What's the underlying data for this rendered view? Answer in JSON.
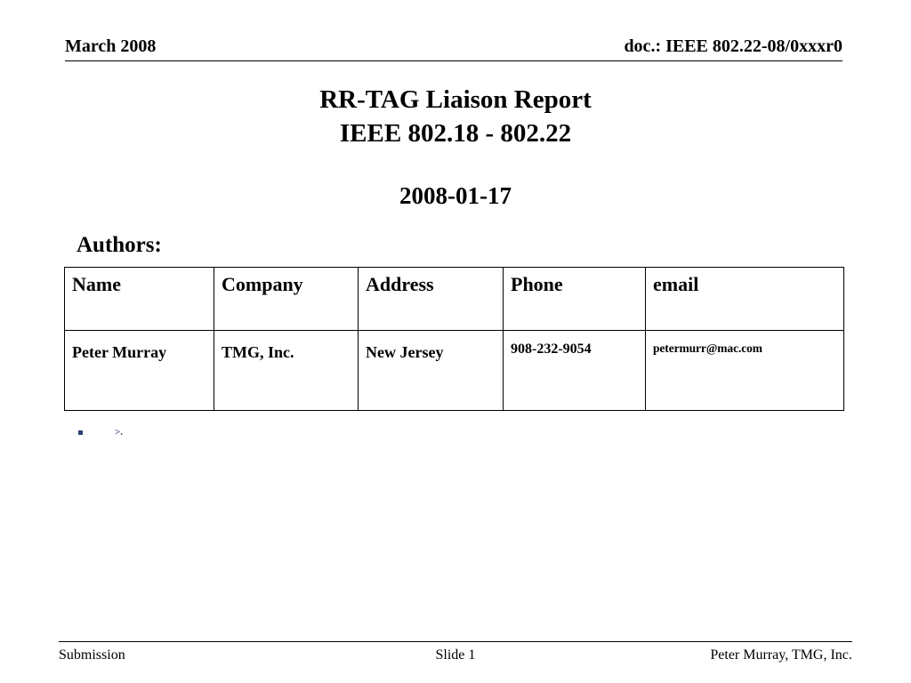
{
  "header": {
    "date": "March 2008",
    "doc_id": "doc.: IEEE 802.22-08/0xxxr0"
  },
  "title": {
    "line1": "RR-TAG Liaison Report",
    "line2": "IEEE 802.18 - 802.22",
    "date": "2008-01-17"
  },
  "authors": {
    "label": "Authors:",
    "columns": [
      "Name",
      "Company",
      "Address",
      "Phone",
      "email"
    ],
    "rows": [
      {
        "name": "Peter Murray",
        "company": "TMG, Inc.",
        "address": "New Jersey",
        "phone": "908-232-9054",
        "email": "petermurr@mac.com"
      }
    ]
  },
  "body": {
    "bullets": [
      {
        "marker": "square-bullet",
        "text": ">."
      }
    ],
    "bullet_color": "#2E4272"
  },
  "footer": {
    "left": "Submission",
    "center": "Slide 1",
    "right": "Peter Murray, TMG, Inc."
  }
}
